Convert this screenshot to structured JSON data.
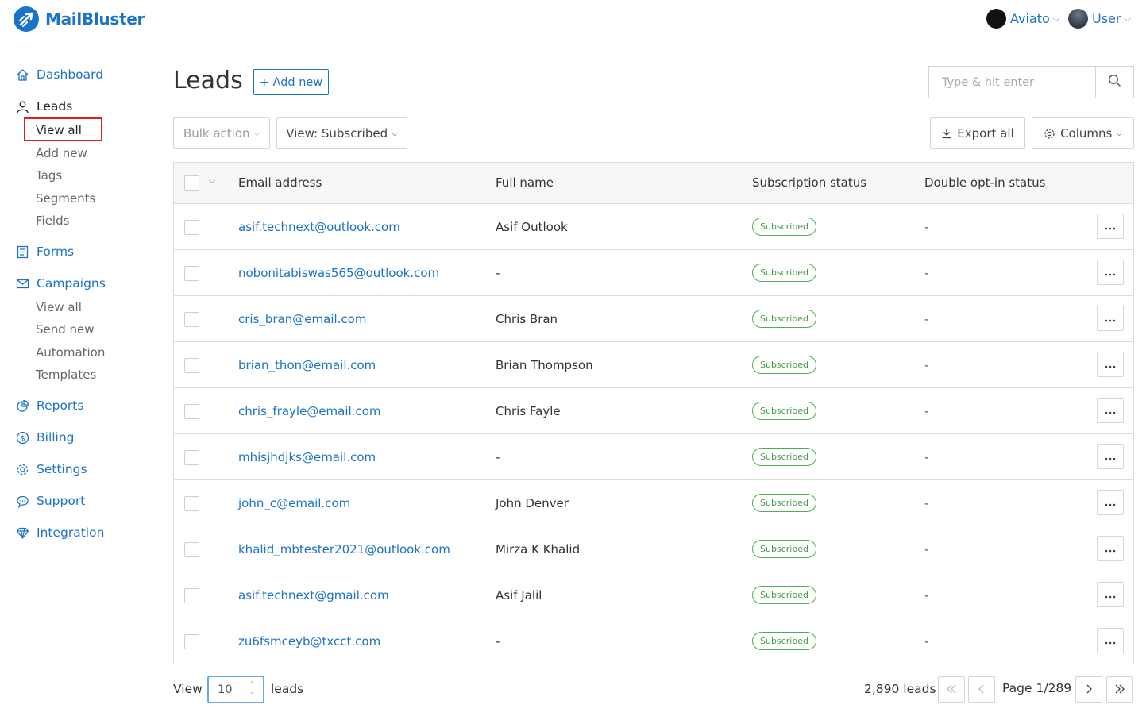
{
  "app": {
    "name": "MailBluster"
  },
  "header": {
    "org_label": "Aviato",
    "user_label": "User"
  },
  "sidebar": {
    "dashboard": "Dashboard",
    "leads": "Leads",
    "leads_sub": [
      "View all",
      "Add new",
      "Tags",
      "Segments",
      "Fields"
    ],
    "forms": "Forms",
    "campaigns": "Campaigns",
    "campaigns_sub": [
      "View all",
      "Send new",
      "Automation",
      "Templates"
    ],
    "reports": "Reports",
    "billing": "Billing",
    "settings": "Settings",
    "support": "Support",
    "integration": "Integration"
  },
  "page": {
    "title": "Leads",
    "add_new_label": "+ Add new",
    "search_placeholder": "Type & hit enter",
    "bulk_action_label": "Bulk action",
    "view_filter_label": "View: Subscribed",
    "export_label": "Export all",
    "columns_label": "Columns"
  },
  "table": {
    "headers": {
      "email": "Email address",
      "name": "Full name",
      "subscription": "Subscription status",
      "optin": "Double opt-in status"
    },
    "rows": [
      {
        "email": "asif.technext@outlook.com",
        "name": "Asif Outlook",
        "status": "Subscribed",
        "optin": "-"
      },
      {
        "email": "nobonitabiswas565@outlook.com",
        "name": "-",
        "status": "Subscribed",
        "optin": "-"
      },
      {
        "email": "cris_bran@email.com",
        "name": "Chris Bran",
        "status": "Subscribed",
        "optin": "-"
      },
      {
        "email": "brian_thon@email.com",
        "name": "Brian Thompson",
        "status": "Subscribed",
        "optin": "-"
      },
      {
        "email": "chris_frayle@email.com",
        "name": "Chris Fayle",
        "status": "Subscribed",
        "optin": "-"
      },
      {
        "email": "mhisjhdjks@email.com",
        "name": "-",
        "status": "Subscribed",
        "optin": "-"
      },
      {
        "email": "john_c@email.com",
        "name": "John Denver",
        "status": "Subscribed",
        "optin": "-"
      },
      {
        "email": "khalid_mbtester2021@outlook.com",
        "name": "Mirza K Khalid",
        "status": "Subscribed",
        "optin": "-"
      },
      {
        "email": "asif.technext@gmail.com",
        "name": "Asif Jalil",
        "status": "Subscribed",
        "optin": "-"
      },
      {
        "email": "zu6fsmceyb@txcct.com",
        "name": "-",
        "status": "Subscribed",
        "optin": "-"
      }
    ]
  },
  "footer": {
    "view_label": "View",
    "per_page": "10",
    "leads_label": "leads",
    "total_label": "2,890 leads",
    "page_label": "Page 1/289"
  },
  "colors": {
    "brand": "#1a73c8",
    "badge_green": "#43a047",
    "highlight_red": "#e02020"
  }
}
